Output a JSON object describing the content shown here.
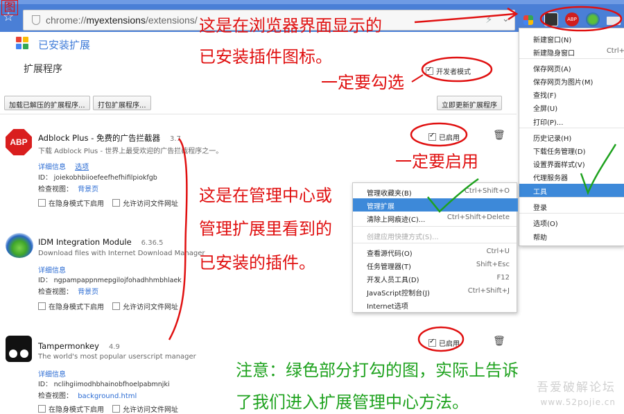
{
  "browser": {
    "url_prefix": "chrome://",
    "url_host": "myextensions",
    "url_path": "/extensions/"
  },
  "corner_label": "图",
  "page": {
    "title": "已安装扩展",
    "subtitle": "扩展程序",
    "developer_mode": "开发者模式"
  },
  "buttons": {
    "load_unpacked": "加载已解压的扩展程序...",
    "pack": "打包扩展程序...",
    "update_now": "立即更新扩展程序"
  },
  "extensions": [
    {
      "name": "Adblock Plus - 免费的广告拦截器",
      "version": "3.7",
      "desc": "下载 Adblock Plus - 世界上最受欢迎的广告拦截程序之一。",
      "details": "详细信息",
      "options": "选项",
      "id": "ID： joiekobhbiioefeefhefhifilpiokfgb",
      "inspect": "检查视图：",
      "inspect_link": "背景页",
      "incognito": "在隐身模式下启用",
      "file_access": "允许访问文件网址",
      "enabled": "已启用",
      "icon_text": "ABP"
    },
    {
      "name": "IDM Integration Module",
      "version": "6.36.5",
      "desc": "Download files with Internet Download Manager",
      "details": "详细信息",
      "id": "ID： ngpampappnmepgilojfohadhhmbhlaek",
      "inspect": "检查视图：",
      "inspect_link": "背景页",
      "incognito": "在隐身模式下启用",
      "file_access": "允许访问文件网址"
    },
    {
      "name": "Tampermonkey",
      "version": "4.9",
      "desc": "The world's most popular userscript manager",
      "details": "详细信息",
      "id": "ID： nclihgiimodhbhainobfhoelpabmnjki",
      "inspect": "检查视图：",
      "inspect_link": "background.html",
      "incognito": "在隐身模式下启用",
      "file_access": "允许访问文件网址",
      "enabled": "已启用"
    }
  ],
  "main_menu": [
    {
      "label": "新建窗口(N)",
      "shortcut": ""
    },
    {
      "label": "新建隐身窗口",
      "shortcut": "Ctrl+"
    },
    {
      "label": "保存网页(A)",
      "shortcut": ""
    },
    {
      "label": "保存网页为图片(M)",
      "shortcut": ""
    },
    {
      "label": "查找(F)",
      "shortcut": ""
    },
    {
      "label": "全屏(U)",
      "shortcut": ""
    },
    {
      "label": "打印(P)...",
      "shortcut": ""
    },
    {
      "label": "历史记录(H)",
      "shortcut": ""
    },
    {
      "label": "下载任务管理(D)",
      "shortcut": ""
    },
    {
      "label": "设置界面样式(V)",
      "shortcut": ""
    },
    {
      "label": "代理服务器",
      "shortcut": ""
    },
    {
      "label": "工具",
      "shortcut": ""
    },
    {
      "label": "登录",
      "shortcut": ""
    },
    {
      "label": "选项(O)",
      "shortcut": ""
    },
    {
      "label": "帮助",
      "shortcut": ""
    }
  ],
  "tools_menu": [
    {
      "label": "管理收藏夹(B)",
      "shortcut": "Ctrl+Shift+O"
    },
    {
      "label": "管理扩展",
      "shortcut": ""
    },
    {
      "label": "清除上网痕迹(C)...",
      "shortcut": "Ctrl+Shift+Delete"
    },
    {
      "label": "创建应用快捷方式(S)...",
      "shortcut": ""
    },
    {
      "label": "查看源代码(O)",
      "shortcut": "Ctrl+U"
    },
    {
      "label": "任务管理器(T)",
      "shortcut": "Shift+Esc"
    },
    {
      "label": "开发人员工具(D)",
      "shortcut": "F12"
    },
    {
      "label": "JavaScript控制台(J)",
      "shortcut": "Ctrl+Shift+J"
    },
    {
      "label": "Internet选项",
      "shortcut": ""
    }
  ],
  "annotations": {
    "toolbar_note_1": "这是在浏览器界面显示的",
    "toolbar_note_2": "已安装插件图标。",
    "must_check": "一定要勾选",
    "must_enable": "一定要启用",
    "manage_note_1": "这是在管理中心或",
    "manage_note_2": "管理扩展里看到的",
    "manage_note_3": "已安装的插件。",
    "green_note_1": "注意：绿色部分打勾的图，实际上告诉",
    "green_note_2": "了我们进入扩展管理中心方法。"
  },
  "watermark": {
    "text": "吾爱破解论坛",
    "url": "www.52pojie.cn"
  },
  "colors": {
    "chrome_blue": "#4a7fd6",
    "link_blue": "#2a6bd3",
    "annotation_red": "#e01010",
    "annotation_green": "#1ea21e",
    "menu_highlight": "#3d89d9"
  }
}
